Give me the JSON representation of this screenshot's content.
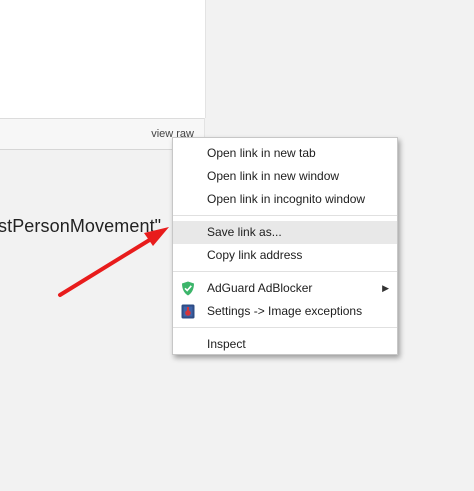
{
  "gist": {
    "view_raw_label": "view raw",
    "code_snippet": "stPersonMovement\""
  },
  "context_menu": {
    "items": [
      {
        "label": "Open link in new tab"
      },
      {
        "label": "Open link in new window"
      },
      {
        "label": "Open link in incognito window"
      },
      {
        "label": "Save link as..."
      },
      {
        "label": "Copy link address"
      },
      {
        "label": "AdGuard AdBlocker",
        "icon": "adguard-shield-icon"
      },
      {
        "label": "Settings -> Image exceptions",
        "icon": "image-settings-icon"
      },
      {
        "label": "Inspect"
      }
    ],
    "highlighted_item": "Save link as..."
  },
  "colors": {
    "background": "#f2f2f2",
    "menu_highlight": "#e8e8e8",
    "annotation_arrow": "#e81c1c",
    "adguard_green": "#3cb56a"
  },
  "icons": [
    "adguard-shield-icon",
    "image-settings-icon",
    "submenu-chevron-right-icon",
    "red-annotation-arrow"
  ]
}
